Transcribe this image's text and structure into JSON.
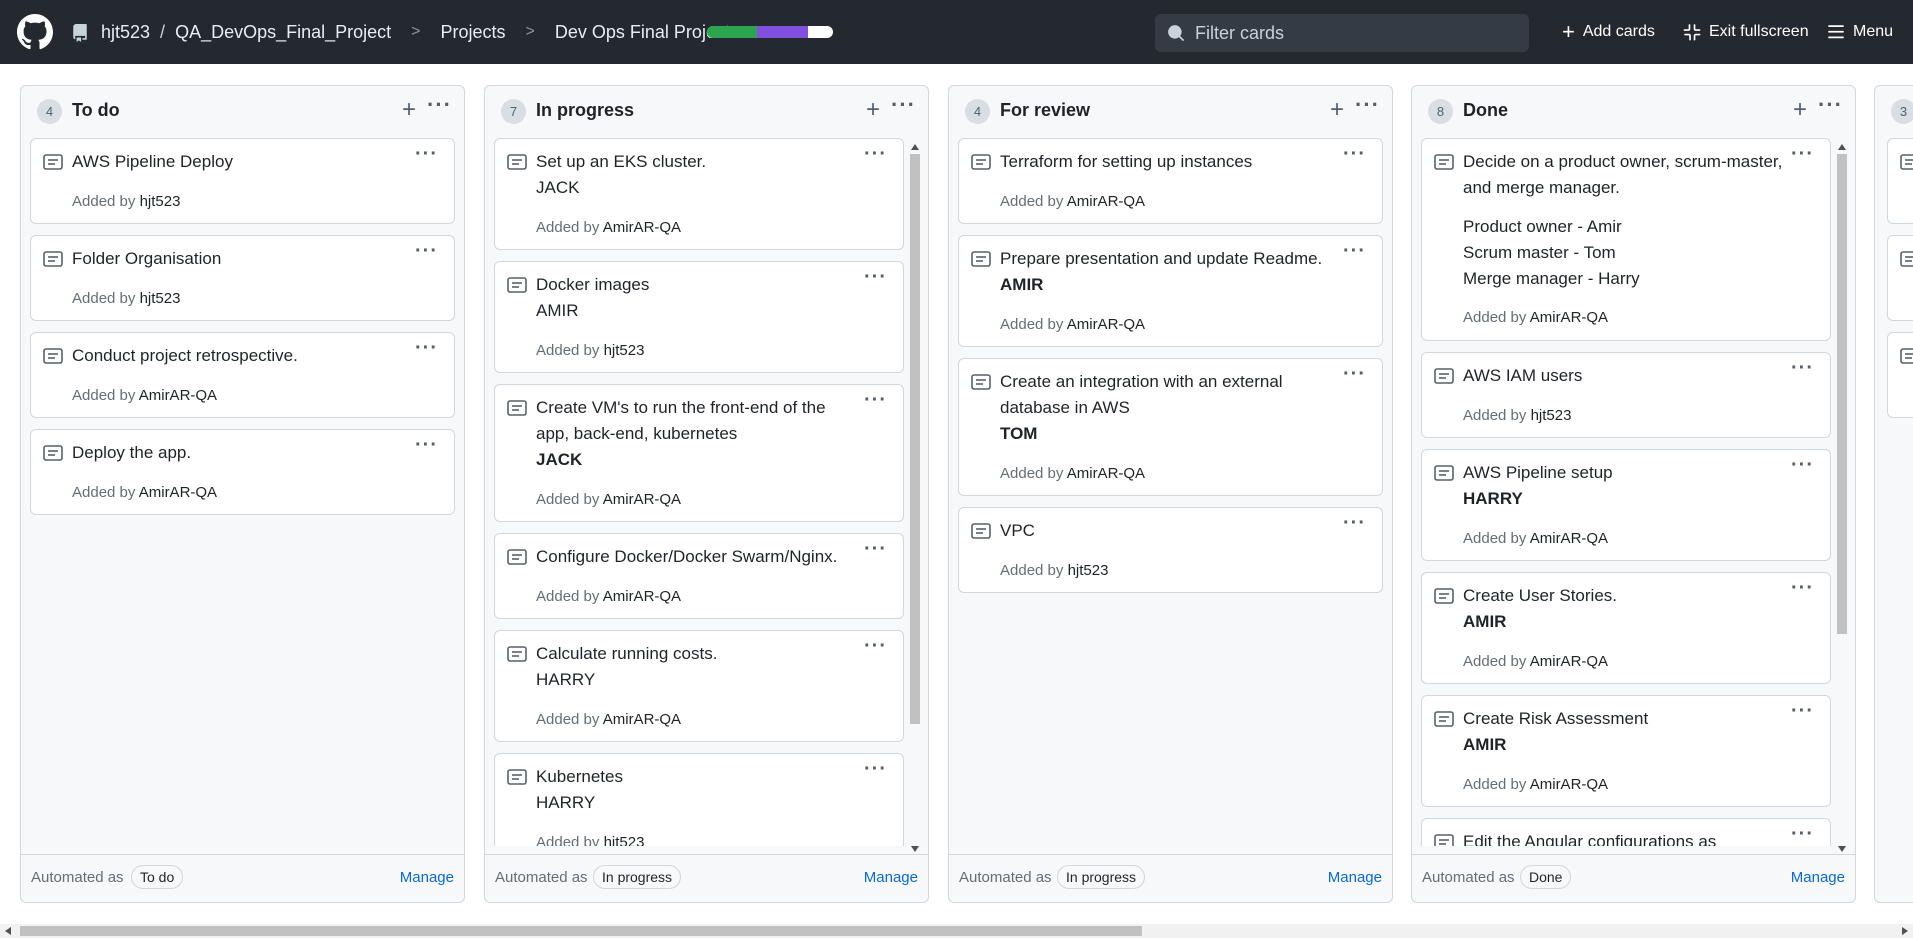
{
  "header": {
    "owner": "hjt523",
    "separator": "/",
    "repo": "QA_DevOps_Final_Project",
    "projects": "Projects",
    "project_name": "Dev Ops Final Project",
    "progress": {
      "done": 0.4,
      "in_progress": 0.4,
      "remaining": 0.2
    },
    "search_placeholder": "Filter cards",
    "add_cards": "Add cards",
    "exit_fullscreen": "Exit fullscreen",
    "menu": "Menu"
  },
  "columns": [
    {
      "count": "4",
      "title": "To do",
      "cards": [
        {
          "title": "AWS Pipeline Deploy",
          "added_prefix": "Added by",
          "added_by": "hjt523"
        },
        {
          "title": "Folder Organisation",
          "added_prefix": "Added by",
          "added_by": "hjt523"
        },
        {
          "title": "Conduct project retrospective.",
          "added_prefix": "Added by",
          "added_by": "AmirAR-QA"
        },
        {
          "title": "Deploy the app.",
          "added_prefix": "Added by",
          "added_by": "AmirAR-QA"
        }
      ],
      "automated_label": "Automated as",
      "automated_value": "To do",
      "manage": "Manage"
    },
    {
      "count": "7",
      "title": "In progress",
      "cards": [
        {
          "title": "Set up an EKS cluster.",
          "assignee": "JACK",
          "added_prefix": "Added by",
          "added_by": "AmirAR-QA"
        },
        {
          "title": "Docker images",
          "assignee": "AMIR",
          "added_prefix": "Added by",
          "added_by": "hjt523"
        },
        {
          "title": "Create VM's to run the front-end of the app, back-end, kubernetes",
          "assignee": "JACK",
          "added_prefix": "Added by",
          "added_by": "AmirAR-QA"
        },
        {
          "title": "Configure Docker/Docker Swarm/Nginx.",
          "added_prefix": "Added by",
          "added_by": "AmirAR-QA"
        },
        {
          "title": "Calculate running costs.",
          "assignee": "HARRY",
          "added_prefix": "Added by",
          "added_by": "AmirAR-QA"
        },
        {
          "title": "Kubernetes",
          "assignee": "HARRY",
          "added_prefix": "Added by",
          "added_by": "hjt523"
        }
      ],
      "automated_label": "Automated as",
      "automated_value": "In progress",
      "manage": "Manage"
    },
    {
      "count": "4",
      "title": "For review",
      "cards": [
        {
          "title": "Terraform for setting up instances",
          "added_prefix": "Added by",
          "added_by": "AmirAR-QA"
        },
        {
          "title": "Prepare presentation and update Readme.",
          "assignee": "AMIR",
          "added_prefix": "Added by",
          "added_by": "AmirAR-QA"
        },
        {
          "title": "Create an integration with an external database in AWS",
          "assignee": "TOM",
          "added_prefix": "Added by",
          "added_by": "AmirAR-QA"
        },
        {
          "title": "VPC",
          "added_prefix": "Added by",
          "added_by": "hjt523"
        }
      ],
      "automated_label": "Automated as",
      "automated_value": "In progress",
      "manage": "Manage"
    },
    {
      "count": "8",
      "title": "Done",
      "cards": [
        {
          "title": "Decide on a product owner, scrum-master, and merge manager.",
          "lines": [
            "Product owner - Amir",
            "Scrum master - Tom",
            "Merge manager - Harry"
          ],
          "added_prefix": "Added by",
          "added_by": "AmirAR-QA"
        },
        {
          "title": "AWS IAM users",
          "added_prefix": "Added by",
          "added_by": "hjt523"
        },
        {
          "title": "AWS Pipeline setup",
          "assignee": "HARRY",
          "added_prefix": "Added by",
          "added_by": "AmirAR-QA"
        },
        {
          "title": "Create User Stories.",
          "assignee": "AMIR",
          "added_prefix": "Added by",
          "added_by": "AmirAR-QA"
        },
        {
          "title": "Create Risk Assessment",
          "assignee": "AMIR",
          "added_prefix": "Added by",
          "added_by": "AmirAR-QA"
        },
        {
          "title": "Edit the Angular configurations as"
        }
      ],
      "automated_label": "Automated as",
      "automated_value": "Done",
      "manage": "Manage"
    }
  ],
  "partial_column": {
    "count": "3"
  },
  "icons": {
    "logo": "github-logo-icon",
    "repo": "repo-icon",
    "search": "search-icon",
    "plus": "plus-icon",
    "exit_fullscreen": "exit-fullscreen-icon",
    "menu": "hamburger-icon",
    "note": "note-icon",
    "kebab": "kebab-horizontal-icon"
  },
  "colors": {
    "header_bg": "#24292f",
    "progress_done": "#2da44e",
    "progress_in_progress": "#8250df",
    "link": "#0969da"
  }
}
